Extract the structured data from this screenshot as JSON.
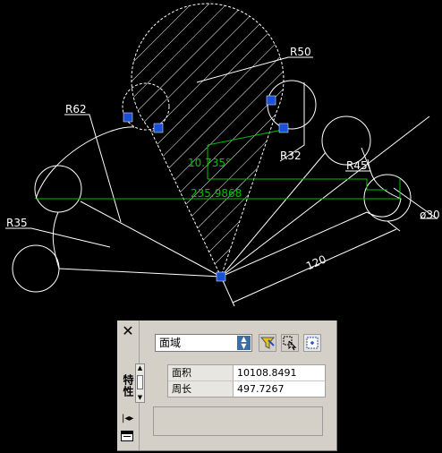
{
  "drawing": {
    "dimensions": {
      "r50": "R50",
      "r62": "R62",
      "r32": "R32",
      "r45": "R45",
      "r35": "R35",
      "d30": "ø30",
      "angle": "10.735°",
      "aligned": "235.9868",
      "len120": "120"
    },
    "colors": {
      "background": "#000000",
      "geometry": "#ffffff",
      "highlight": "#00c000",
      "grip": "#1a4fd8"
    }
  },
  "palette": {
    "title": "特性",
    "object_type": "面域",
    "properties": [
      {
        "name": "面积",
        "value": "10108.8491"
      },
      {
        "name": "周长",
        "value": "497.7267"
      }
    ],
    "icons": {
      "close": "close-icon",
      "quick_select": "quick-select-icon",
      "select_objects": "select-objects-icon",
      "toggle_pickadd": "toggle-pickadd-icon"
    }
  }
}
